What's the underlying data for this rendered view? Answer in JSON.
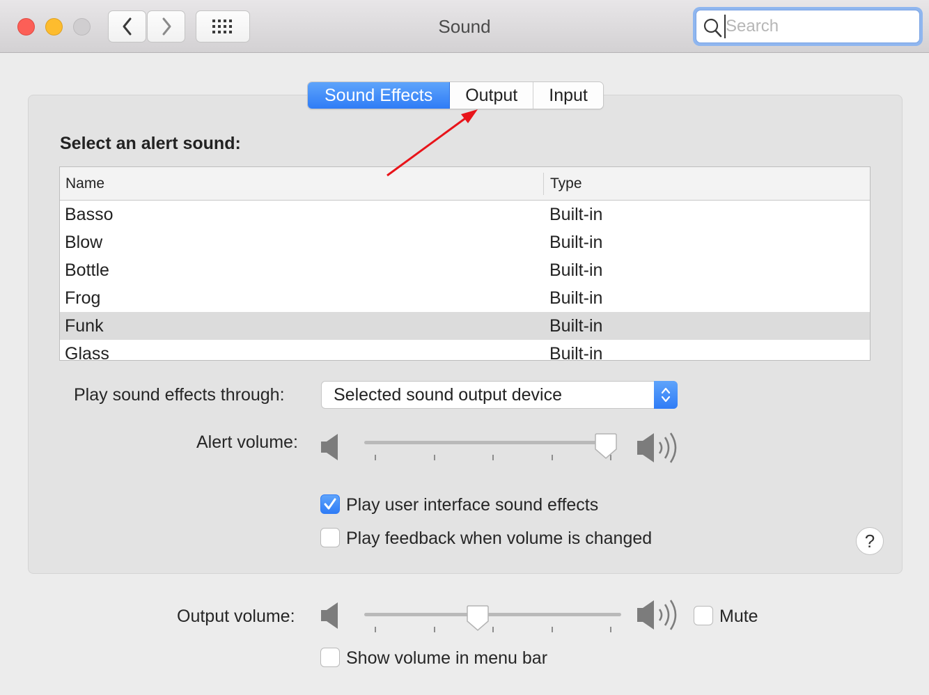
{
  "window": {
    "title": "Sound"
  },
  "toolbar": {
    "search_placeholder": "Search"
  },
  "tabs": [
    {
      "label": "Sound Effects",
      "active": true
    },
    {
      "label": "Output",
      "active": false
    },
    {
      "label": "Input",
      "active": false
    }
  ],
  "sound_effects": {
    "section_label": "Select an alert sound:",
    "columns": {
      "name": "Name",
      "type": "Type"
    },
    "rows": [
      {
        "name": "Basso",
        "type": "Built-in"
      },
      {
        "name": "Blow",
        "type": "Built-in"
      },
      {
        "name": "Bottle",
        "type": "Built-in"
      },
      {
        "name": "Frog",
        "type": "Built-in"
      },
      {
        "name": "Funk",
        "type": "Built-in"
      },
      {
        "name": "Glass",
        "type": "Built-in"
      }
    ],
    "selected_row": "Funk",
    "play_through_label": "Play sound effects through:",
    "play_through_value": "Selected sound output device",
    "alert_volume_label": "Alert volume:",
    "alert_volume_level": 1.0,
    "ui_sounds_label": "Play user interface sound effects",
    "ui_sounds_checked": true,
    "feedback_label": "Play feedback when volume is changed",
    "feedback_checked": false,
    "help_label": "?"
  },
  "footer": {
    "output_volume_label": "Output volume:",
    "output_volume_level": 0.44,
    "mute_label": "Mute",
    "mute_checked": false,
    "menu_bar_label": "Show volume in menu bar",
    "menu_bar_checked": false
  },
  "colors": {
    "accent": "#2f7cf6",
    "annotation_arrow": "#e8141a"
  }
}
